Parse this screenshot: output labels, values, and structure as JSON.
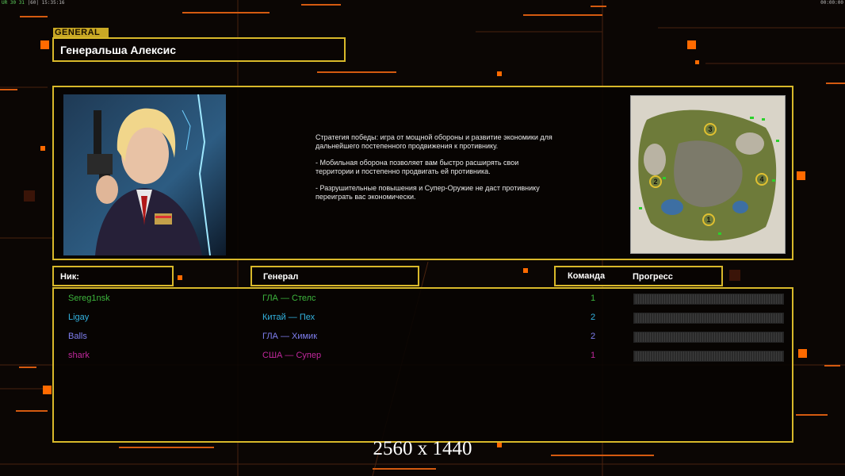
{
  "topbar": {
    "fps_label": "UR",
    "fps_values": "30 31",
    "ping": "|60|",
    "clock": "15:35:16",
    "timer": "00:00:00"
  },
  "general_tag": "GENERAL",
  "general_name": "Генеральша Алексис",
  "description": [
    "Стратегия победы: игра от мощной обороны и развитие экономики для дальнейшего постепенного продвижения к противнику.",
    "- Мобильная оборона позволяет вам быстро расширять свои территории и постепенно продвигать ей противника.",
    "- Разрушительные повышения и Супер-Оружие не даст противнику переиграть вас экономически."
  ],
  "map": {
    "start_positions": [
      "3",
      "2",
      "4",
      "1"
    ]
  },
  "headers": {
    "nick": "Ник:",
    "general": "Генерал",
    "team": "Команда",
    "progress": "Прогресс"
  },
  "players": [
    {
      "nick": "Sereg1nsk",
      "general": "ГЛА — Стелс",
      "team": "1",
      "color": "#3db53d",
      "progress": 0
    },
    {
      "nick": "Ligay",
      "general": "Китай — Пех",
      "team": "2",
      "color": "#33b3e0",
      "progress": 0
    },
    {
      "nick": "Balls",
      "general": "ГЛА — Химик",
      "team": "2",
      "color": "#7f7ff0",
      "progress": 0
    },
    {
      "nick": "shark",
      "general": "США — Супер",
      "team": "1",
      "color": "#c0289c",
      "progress": 0
    }
  ],
  "resolution_label": "2560 x 1440",
  "colors": {
    "accent": "#d8b82a",
    "highlight": "#ff6a00"
  }
}
